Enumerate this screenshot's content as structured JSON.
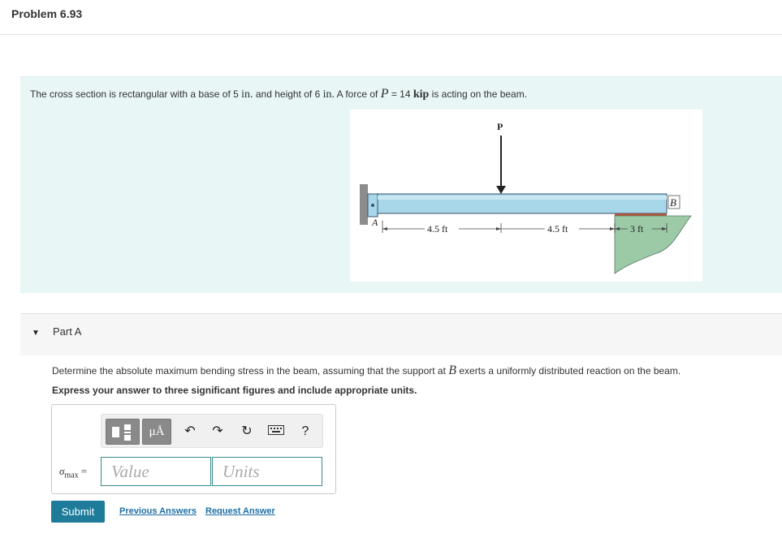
{
  "page": {
    "title": "Problem 6.93"
  },
  "intro": {
    "t1": "The cross section is rectangular with a base of 5 ",
    "unit_in": "in.",
    "t2": " and height of 6 ",
    "t3": " A force of ",
    "P": "P",
    "t4": " = 14 ",
    "kip": "kip",
    "t5": " is acting on the beam."
  },
  "figure": {
    "load_label": "P",
    "support_label": "B",
    "wall_label": "A",
    "dim1": "4.5 ft",
    "dim2": "4.5 ft",
    "dim3": "3 ft",
    "colors": {
      "beam": "#a9d7ea",
      "ground": "#9ccaa7",
      "bearing": "#b4523c"
    }
  },
  "partA": {
    "title": "Part A",
    "q1": "Determine the absolute maximum bending stress in the beam, assuming that the support at ",
    "B": "B",
    "q2": " exerts a uniformly distributed reaction on the beam.",
    "express": "Express your answer to three significant figures and include appropriate units."
  },
  "answer": {
    "label_sigma": "σ",
    "label_sub": "max",
    "label_eq": " =",
    "value_placeholder": "Value",
    "units_placeholder": "Units",
    "unit_btn": "μÅ",
    "help_icon": "?"
  },
  "actions": {
    "submit": "Submit",
    "previous": "Previous Answers",
    "request": "Request Answer"
  }
}
